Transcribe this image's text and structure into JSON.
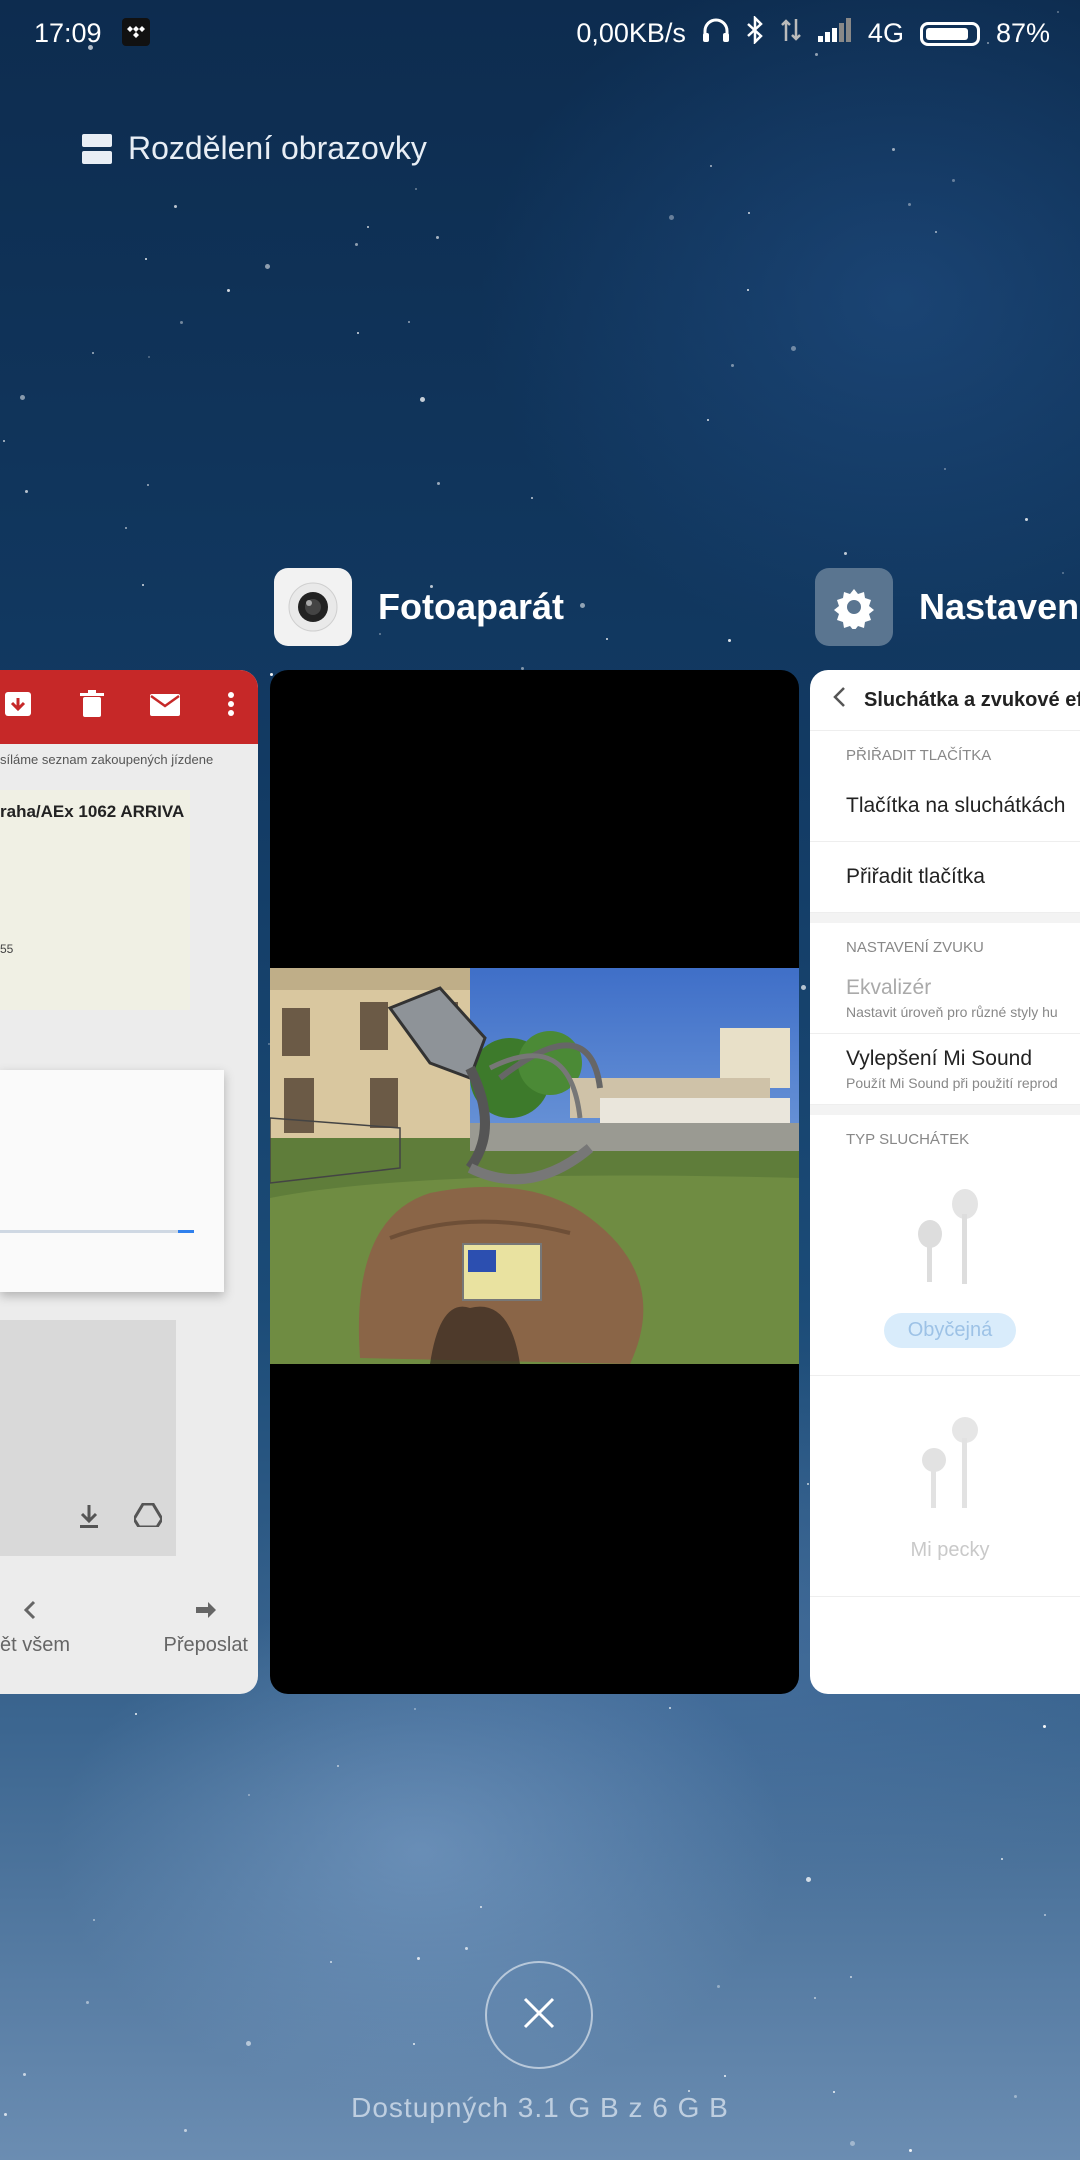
{
  "status_bar": {
    "time": "17:09",
    "network_speed": "0,00KB/s",
    "network_type": "4G",
    "battery": "87%",
    "battery_level": 0.87,
    "icons": [
      "tidal-icon",
      "headphones-icon",
      "bluetooth-icon",
      "data-transfer-icon",
      "signal-icon",
      "battery-icon"
    ]
  },
  "split_screen": {
    "label": "Rozdělení obrazovky",
    "icon": "split-screen-icon"
  },
  "apps": {
    "camera": {
      "title": "Fotoaparát",
      "icon": "camera-icon"
    },
    "settings": {
      "title": "Nastavení",
      "icon": "gear-icon"
    }
  },
  "gmail_card": {
    "subject_line": "síláme seznam zakoupených jízdene",
    "document_title": "raha/AEx 1062 ARRIVA",
    "doc_fragment": "55",
    "actions": [
      {
        "label": "ět všem",
        "icon": "reply-all-icon"
      },
      {
        "label": "Přeposlat",
        "icon": "forward-icon"
      }
    ]
  },
  "settings_card": {
    "header_title": "Sluchátka a zvukové efe",
    "sections": {
      "assign_buttons": "PŘIŘADIT TLAČÍTKA",
      "sound_settings": "NASTAVENÍ ZVUKU",
      "headphone_type": "TYP SLUCHÁTEK"
    },
    "items": {
      "headset_buttons": "Tlačítka na sluchátkách",
      "assign_buttons": "Přiřadit tlačítka",
      "equalizer": "Ekvalizér",
      "equalizer_sub": "Nastavit úroveň pro různé styly hu",
      "mi_sound": "Vylepšení Mi Sound",
      "mi_sound_sub": "Použít Mi Sound při použití reprod"
    },
    "headphone_types": [
      {
        "label": "Obyčejná",
        "selected": true
      },
      {
        "label": "Mi pecky",
        "selected": false
      }
    ]
  },
  "close_button": {
    "icon": "close-icon"
  },
  "memory": "Dostupných 3.1 G B z 6 G B"
}
